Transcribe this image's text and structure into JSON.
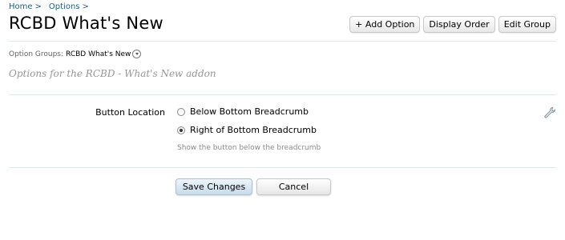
{
  "breadcrumb": {
    "items": [
      "Home",
      "Options"
    ],
    "separator": ">"
  },
  "page": {
    "title": "RCBD What's New"
  },
  "top_actions": {
    "add_option": "+ Add Option",
    "display_order": "Display Order",
    "edit_group": "Edit Group"
  },
  "option_groups": {
    "label": "Option Groups:",
    "selected": "RCBD What's New"
  },
  "group_description": "Options for the RCBD - What's New addon",
  "option": {
    "label": "Button Location",
    "choices": [
      {
        "label": "Below Bottom Breadcrumb",
        "checked": false
      },
      {
        "label": "Right of Bottom Breadcrumb",
        "checked": true
      }
    ],
    "explain": "Show the button below the breadcrumb"
  },
  "form_actions": {
    "save": "Save Changes",
    "cancel": "Cancel"
  },
  "colors": {
    "link": "#176093",
    "divider": "#d7edf2",
    "save_button_top": "#eef5fa",
    "save_button_bottom": "#c7dbe9"
  },
  "icons": {
    "edit": "wrench-icon",
    "dropdown": "chevron-down-icon"
  }
}
